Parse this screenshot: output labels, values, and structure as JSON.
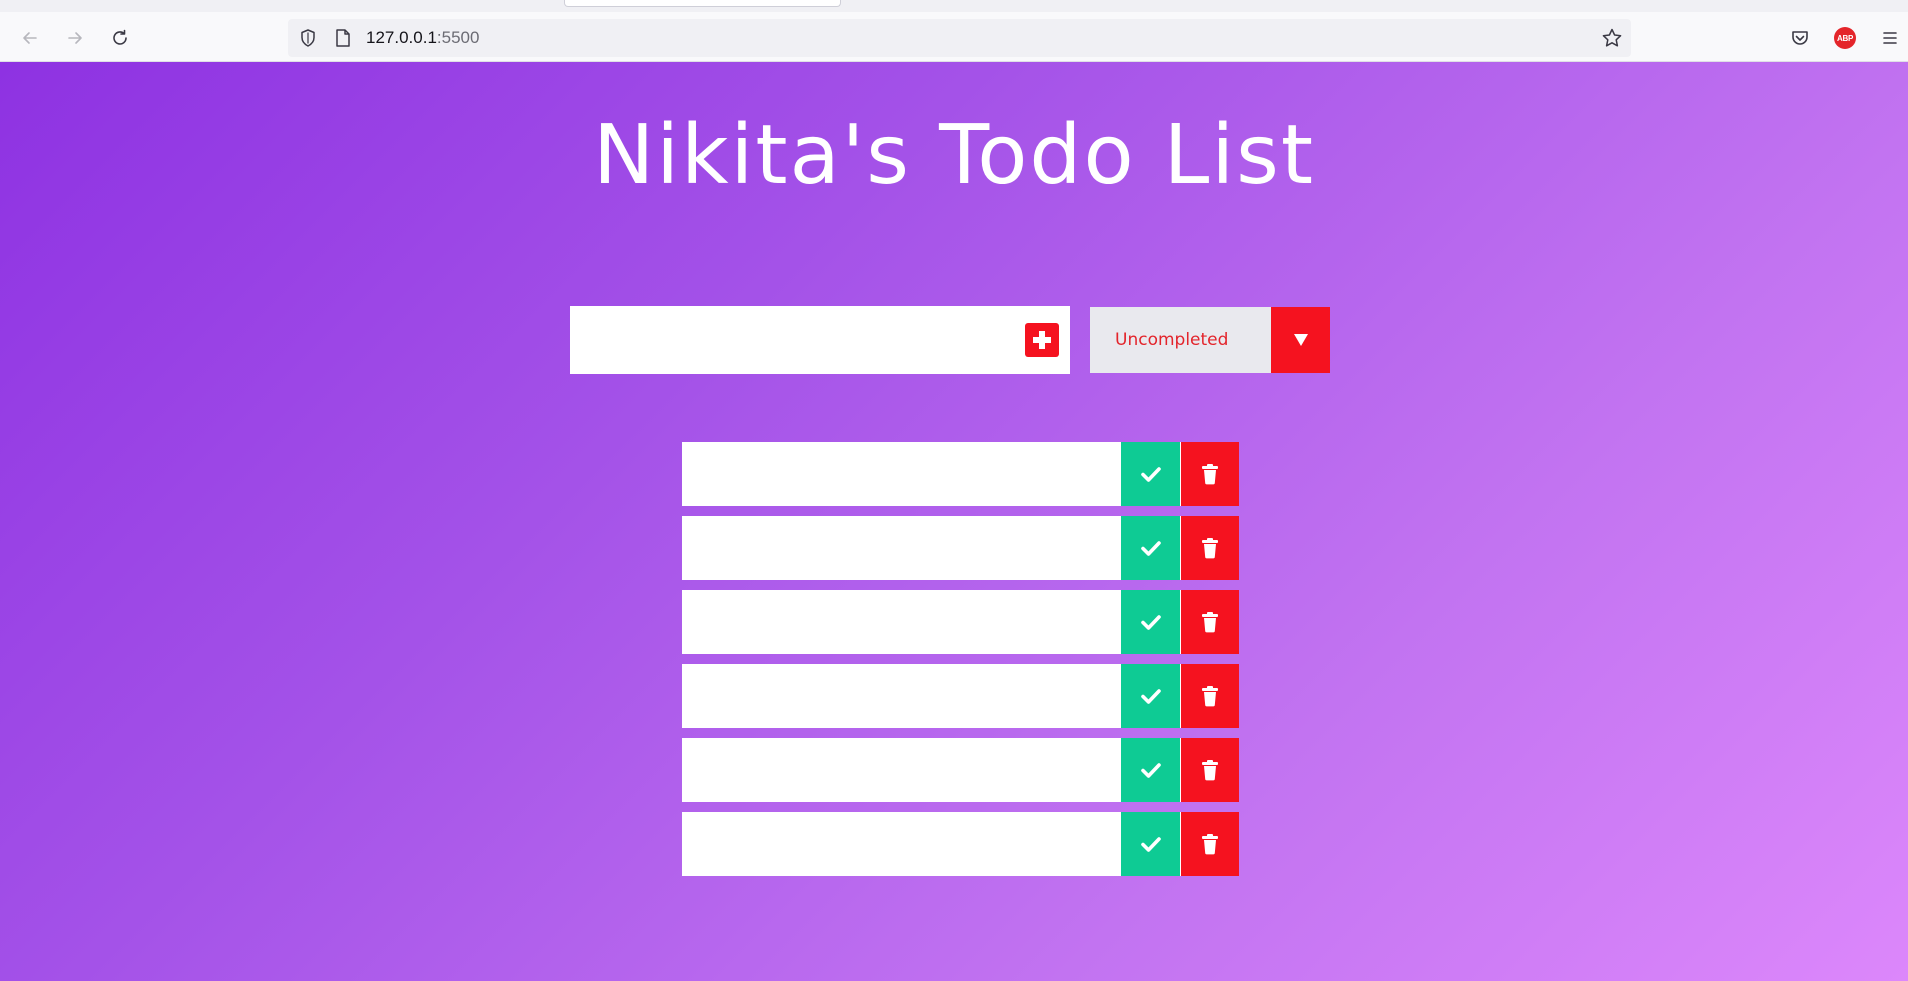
{
  "browser": {
    "url_host": "127.0.0.1",
    "url_port": ":5500",
    "adblock_badge": "ABP"
  },
  "app": {
    "title": "Nikita's Todo List",
    "input": {
      "value": "",
      "placeholder": ""
    },
    "filter": {
      "selected": "Uncompleted"
    },
    "todos": [
      {
        "text": ""
      },
      {
        "text": ""
      },
      {
        "text": ""
      },
      {
        "text": ""
      },
      {
        "text": ""
      },
      {
        "text": ""
      }
    ]
  },
  "colors": {
    "gradient_start": "#8e32e2",
    "gradient_end": "#dc87fb",
    "accent_red": "#f5121f",
    "complete_green": "#0ecb94",
    "filter_background": "#e9e9ee"
  },
  "icons": {
    "back": "arrow-left-icon",
    "forward": "arrow-right-icon",
    "reload": "reload-icon",
    "shield": "shield-icon",
    "page": "page-icon",
    "bookmark": "star-icon",
    "pocket": "pocket-icon",
    "adblock": "adblock-icon",
    "menu": "hamburger-menu-icon",
    "add": "plus-square-icon",
    "dropdown": "caret-down-icon",
    "complete": "check-icon",
    "delete": "trash-icon"
  }
}
